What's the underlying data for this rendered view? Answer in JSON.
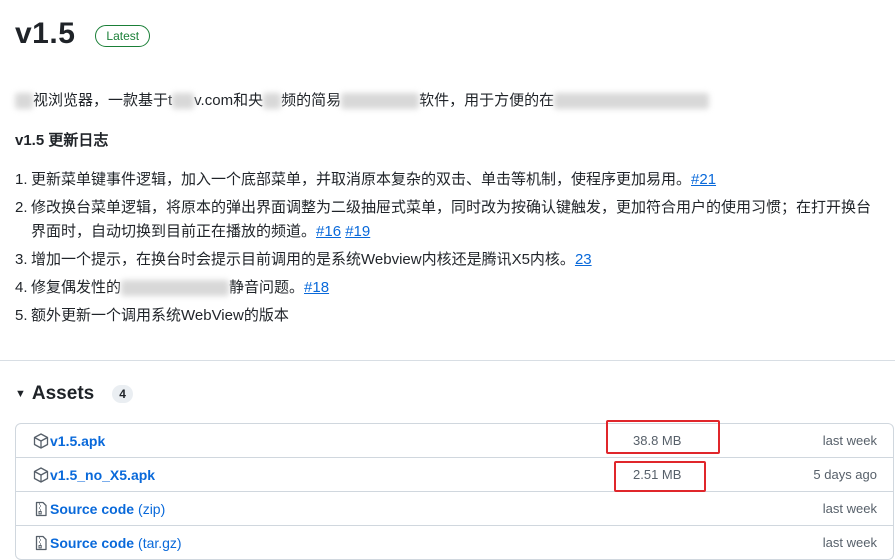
{
  "release": {
    "version": "v1.5",
    "badge": "Latest"
  },
  "intro": {
    "part1": "视浏览器，一款基于t",
    "part2": "v.com和央",
    "part3": "频的简易",
    "part4": "软件，用于方便的在"
  },
  "changelog": {
    "heading": "v1.5 更新日志",
    "items": [
      {
        "num": "1.",
        "text": "更新菜单键事件逻辑，加入一个底部菜单，并取消原本复杂的双击、单击等机制，使程序更加易用。",
        "links": [
          "#21"
        ]
      },
      {
        "num": "2.",
        "text": "修改换台菜单逻辑，将原本的弹出界面调整为二级抽屉式菜单，同时改为按确认键触发，更加符合用户的使用习惯；在打开换台界面时，自动切换到目前正在播放的频道。",
        "links": [
          "#16",
          "#19"
        ]
      },
      {
        "num": "3.",
        "text": "增加一个提示，在换台时会提示目前调用的是系统Webview内核还是腾讯X5内核。",
        "links": [
          "23"
        ]
      },
      {
        "num": "4.",
        "text_a": "修复偶发性的",
        "text_b": "静音问题。",
        "links": [
          "#18"
        ]
      },
      {
        "num": "5.",
        "text": "额外更新一个调用系统WebView的版本",
        "links": []
      }
    ]
  },
  "assets": {
    "title": "Assets",
    "count": "4",
    "rows": [
      {
        "name": "v1.5.apk",
        "sub": "",
        "size": "38.8 MB",
        "date": "last week",
        "icon": "package-icon"
      },
      {
        "name": "v1.5_no_X5.apk",
        "sub": "",
        "size": "2.51 MB",
        "date": "5 days ago",
        "icon": "package-icon"
      },
      {
        "name": "Source code",
        "sub": "(zip)",
        "size": "",
        "date": "last week",
        "icon": "file-zip-icon"
      },
      {
        "name": "Source code",
        "sub": "(tar.gz)",
        "size": "",
        "date": "last week",
        "icon": "file-zip-icon"
      }
    ]
  },
  "colors": {
    "link": "#0969da",
    "latest": "#1a7f37",
    "highlight": "#e0262b"
  }
}
